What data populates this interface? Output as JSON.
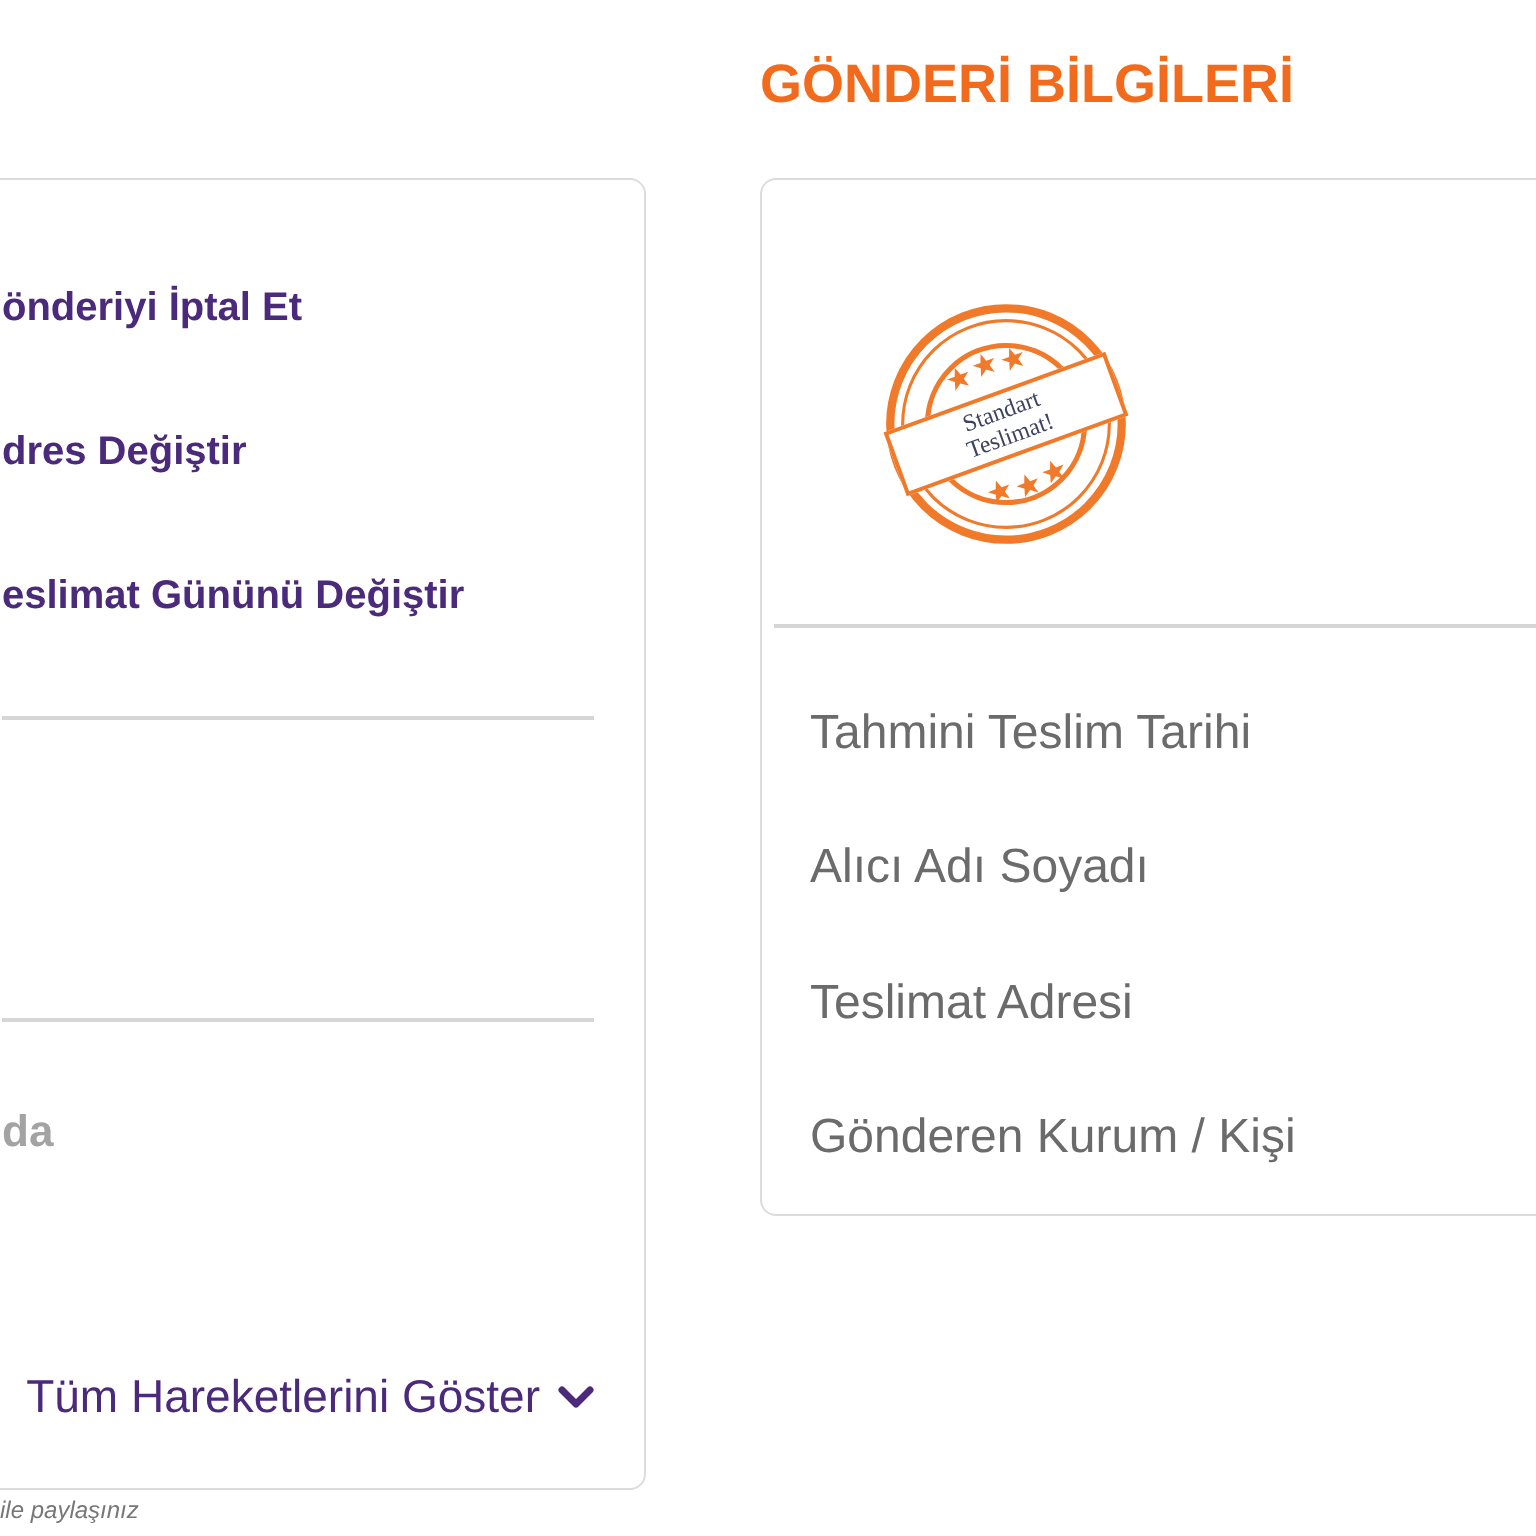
{
  "left_panel": {
    "actions": [
      {
        "label": "önderiyi İptal Et"
      },
      {
        "label": "dres Değiştir"
      },
      {
        "label": "eslimat Gününü Değiştir"
      }
    ],
    "status_text": "da",
    "show_all_link": {
      "label": "Tüm Hareketlerini Göster"
    }
  },
  "footer_note": "ile paylaşınız",
  "shipment_info": {
    "title": "GÖNDERİ BİLGİLERİ",
    "stamp": {
      "text": "Standart Teslimat!"
    },
    "field_labels": [
      "Tahmini Teslim Tarihi",
      "Alıcı Adı Soyadı",
      "Teslimat Adresi",
      "Gönderen Kurum / Kişi"
    ]
  }
}
